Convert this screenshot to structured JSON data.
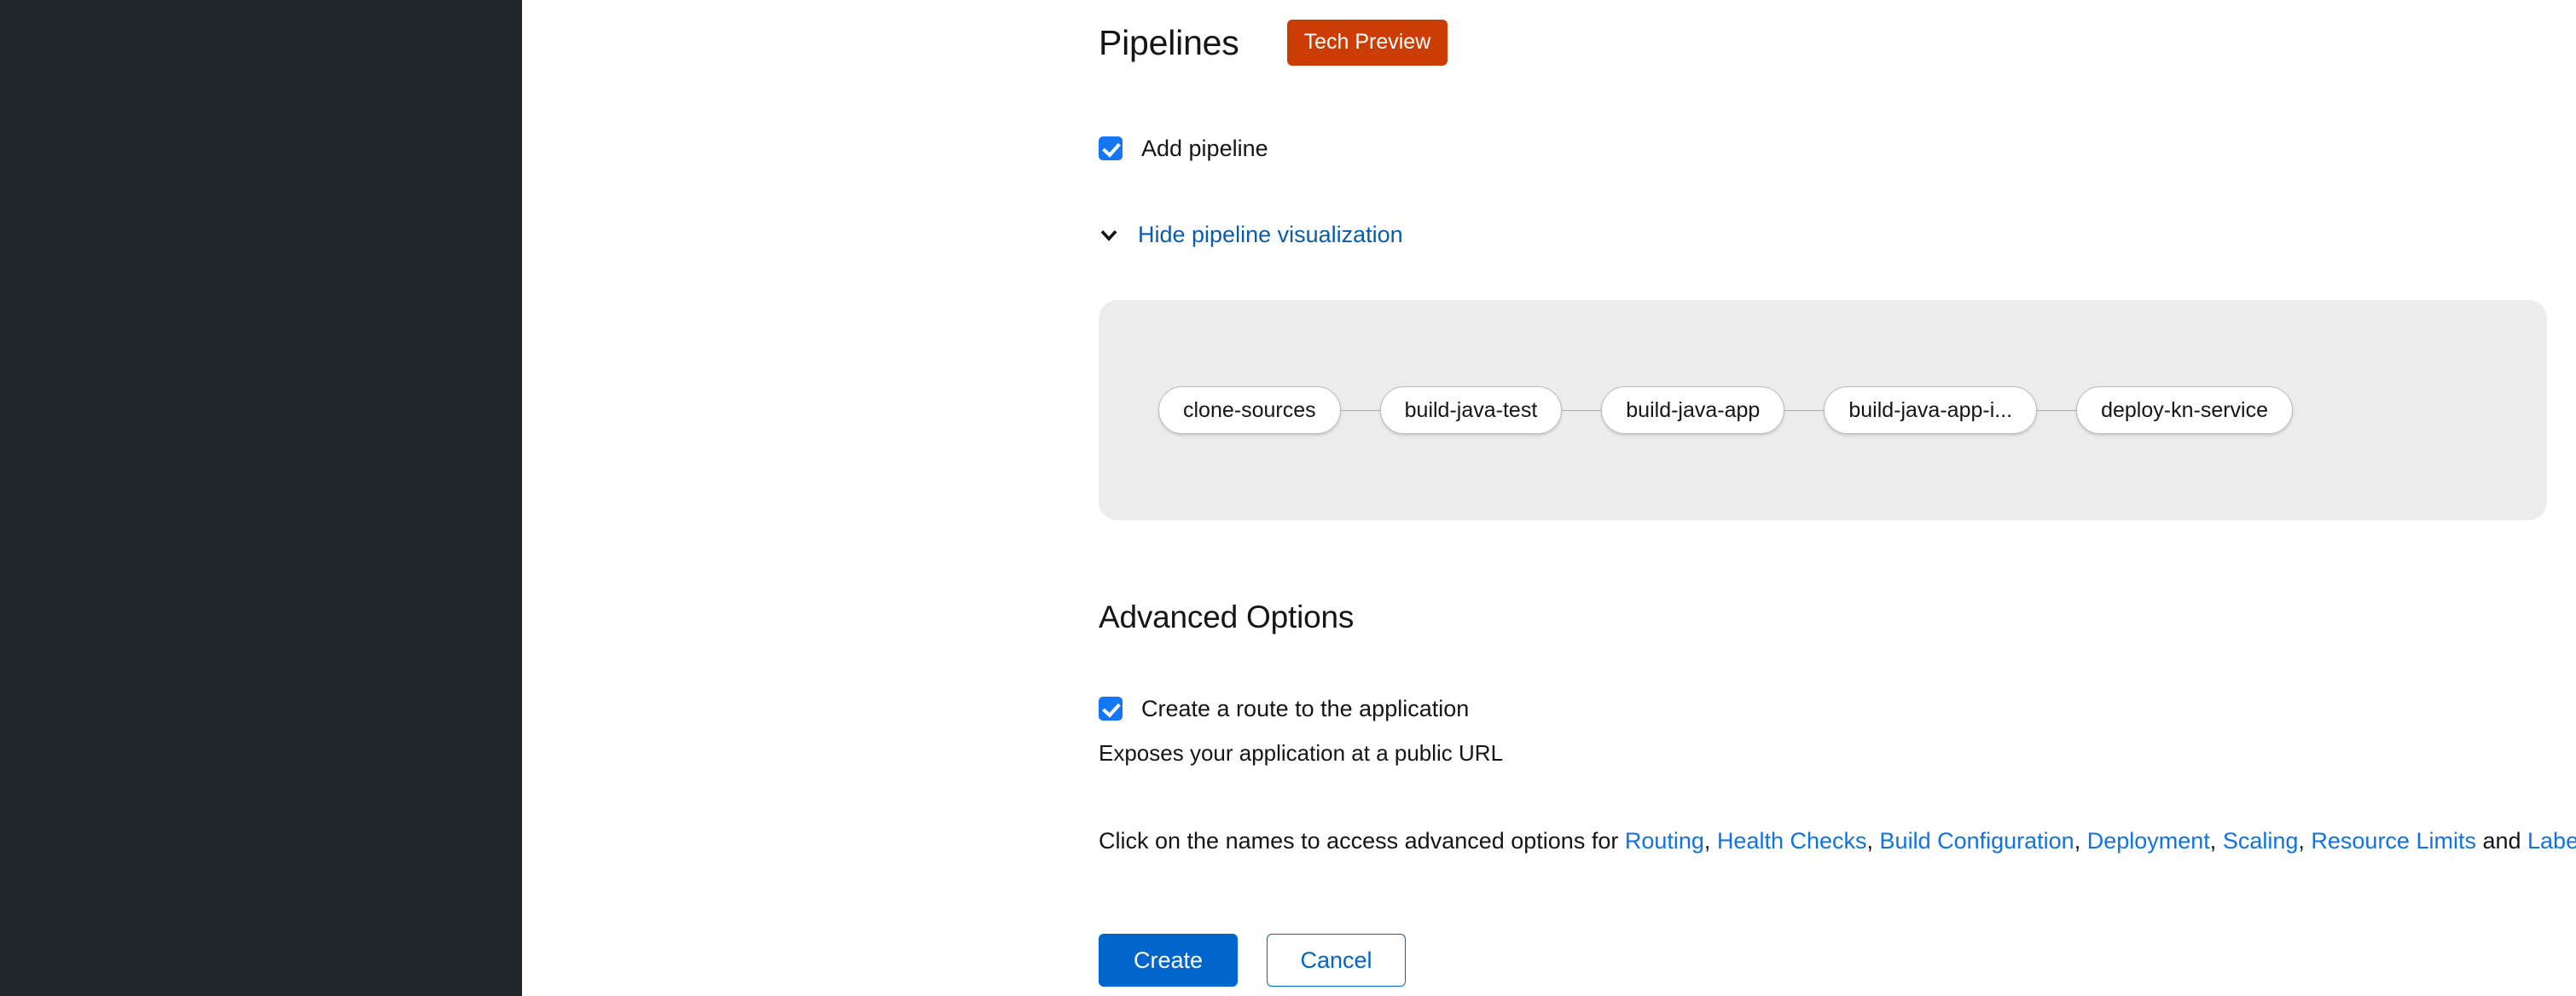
{
  "pipelines": {
    "title": "Pipelines",
    "badge": "Tech Preview",
    "add_pipeline_label": "Add pipeline",
    "toggle_label": "Hide pipeline visualization",
    "toggle_icon": "chevron-down-icon",
    "visualization": {
      "nodes": [
        {
          "label": "clone-sources"
        },
        {
          "label": "build-java-test"
        },
        {
          "label": "build-java-app"
        },
        {
          "label": "build-java-app-i..."
        },
        {
          "label": "deploy-kn-service"
        }
      ]
    }
  },
  "advanced_options": {
    "title": "Advanced Options",
    "route_checkbox_label": "Create a route to the application",
    "route_helper_text": "Exposes your application at a public URL",
    "links_intro": "Click on the names to access advanced options for ",
    "links": [
      {
        "label": "Routing",
        "separator": ", "
      },
      {
        "label": "Health Checks",
        "separator": ", "
      },
      {
        "label": "Build Configuration",
        "separator": ", "
      },
      {
        "label": "Deployment",
        "separator": ", "
      },
      {
        "label": "Scaling",
        "separator": ", "
      },
      {
        "label": "Resource Limits",
        "separator": " and "
      },
      {
        "label": "Labels",
        "separator": "."
      }
    ]
  },
  "actions": {
    "create_label": "Create",
    "cancel_label": "Cancel"
  },
  "colors": {
    "sidebar": "#21262b",
    "badge_orange": "#cc3d06",
    "link_blue": "#0f72e5",
    "toggle_link_blue": "#0b5ca8",
    "checkbox_blue": "#1476f2",
    "primary_button": "#0066cc",
    "panel_background": "#ececec",
    "node_border": "#b8bbbe"
  }
}
